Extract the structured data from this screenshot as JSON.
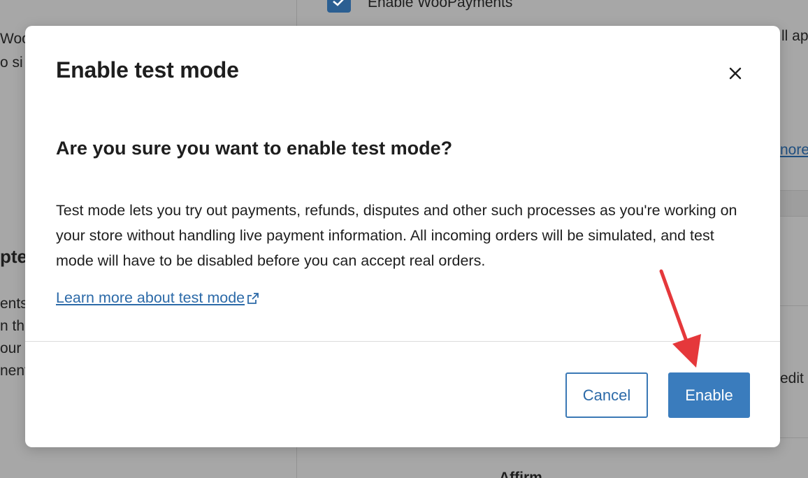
{
  "background": {
    "left_fragments": [
      "Wool",
      "o si",
      "pte",
      "ents",
      "n th",
      "our",
      "nent"
    ],
    "checkbox_label": "Enable WooPayments",
    "right_fragments": [
      "ll ap",
      "nore",
      "edit"
    ],
    "bottom_label": "Affirm"
  },
  "modal": {
    "title": "Enable test mode",
    "close_label": "×",
    "subtitle": "Are you sure you want to enable test mode?",
    "body": "Test mode lets you try out payments, refunds, disputes and other such processes as you're working on your store without handling live payment information. All incoming orders will be simulated, and test mode will have to be disabled before you can accept real orders.",
    "learn_more_link": "Learn more about test mode",
    "cancel_label": "Cancel",
    "enable_label": "Enable"
  },
  "colors": {
    "primary": "#3a7cbd",
    "link": "#2c6aa8",
    "annotation": "#e5383b",
    "overlay": "#a7a7a7"
  }
}
